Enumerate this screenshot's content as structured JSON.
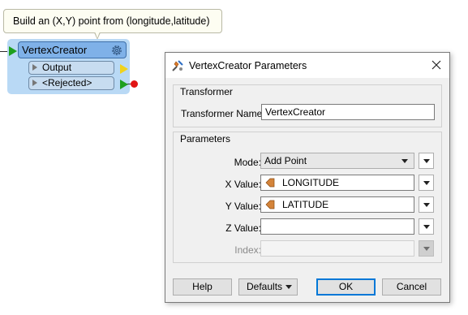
{
  "canvas": {
    "annotation_text": "Build an (X,Y) point from (longitude,latitude)",
    "transformer": {
      "name": "VertexCreator",
      "ports": [
        "Output",
        "<Rejected>"
      ]
    }
  },
  "dialog": {
    "title": "VertexCreator Parameters",
    "transformer_group": {
      "title": "Transformer",
      "name_label": "Transformer Name:",
      "name_value": "VertexCreator"
    },
    "parameters_group": {
      "title": "Parameters",
      "mode_label": "Mode:",
      "mode_value": "Add Point",
      "x_label": "X Value:",
      "x_value": "LONGITUDE",
      "y_label": "Y Value:",
      "y_value": "LATITUDE",
      "z_label": "Z Value:",
      "z_value": "",
      "index_label": "Index:",
      "index_value": ""
    },
    "buttons": {
      "help": "Help",
      "defaults": "Defaults",
      "ok": "OK",
      "cancel": "Cancel"
    }
  },
  "colors": {
    "transformer_fill": "#b9d9f5",
    "transformer_header": "#7fb1e8",
    "input_port": "#1ea01e",
    "output_port": "#f0d21c",
    "rejected_dot": "#e11414",
    "default_button_border": "#0078d7"
  },
  "icons": {
    "app": "vertex-creator-icon",
    "gear": "gear-icon",
    "close": "close-icon",
    "attribute": "attribute-icon",
    "dropdown": "chevron-down-icon",
    "port": "port-triangle-icon"
  }
}
